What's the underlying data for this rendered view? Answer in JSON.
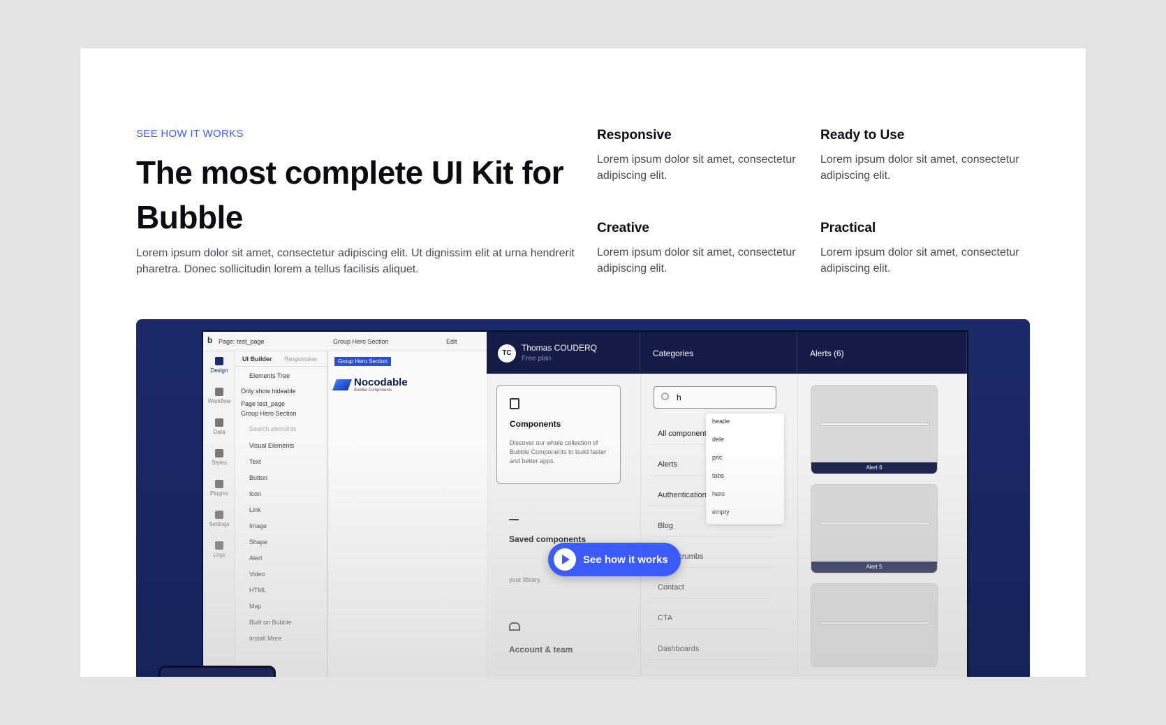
{
  "hero": {
    "eyebrow": "SEE HOW IT WORKS",
    "title": "The most complete UI Kit for Bubble",
    "intro": "Lorem ipsum dolor sit amet, consectetur adipiscing elit. Ut dignissim elit at urna hendrerit pharetra. Donec sollicitudin lorem a tellus facilisis aliquet."
  },
  "features": [
    {
      "title": "Responsive",
      "text": "Lorem ipsum dolor sit amet, consectetur adipiscing elit."
    },
    {
      "title": "Ready to Use",
      "text": "Lorem ipsum dolor sit amet, consectetur adipiscing elit."
    },
    {
      "title": "Creative",
      "text": "Lorem ipsum dolor sit amet, consectetur adipiscing elit."
    },
    {
      "title": "Practical",
      "text": "Lorem ipsum dolor sit amet, consectetur adipiscing elit."
    }
  ],
  "video": {
    "play_label": "See how it works",
    "editor": {
      "page": "Page: test_page",
      "group": "Group Hero Section",
      "edit": "Edit",
      "rail": [
        "Design",
        "Workflow",
        "Data",
        "Styles",
        "Plugins",
        "Settings",
        "Logs"
      ],
      "tabs": [
        "UI Builder",
        "Responsive"
      ],
      "tree": [
        "Elements Tree",
        "Only show hideable",
        "Page test_page",
        "Group Hero Section",
        "Search elements",
        "Visual Elements",
        "Text",
        "Button",
        "Icon",
        "Link",
        "Image",
        "Shape",
        "Alert",
        "Video",
        "HTML",
        "Map",
        "Built on Bubble",
        "Install More"
      ],
      "canvas_tag": "Group Hero Section",
      "logo_name": "Nocodable",
      "logo_sub": "Bubble Components"
    },
    "plugin": {
      "user_initials": "TC",
      "user_name": "Thomas COUDERQ",
      "user_plan": "Free plan",
      "categories_label": "Categories",
      "alerts_label": "Alerts (6)",
      "search_value": "h",
      "suggestions": [
        "heade",
        "dele",
        "pric",
        "tabs",
        "hero",
        "empty"
      ],
      "categories": [
        "All components",
        "Alerts",
        "Authentication",
        "Blog",
        "Breadcrumbs",
        "Contact",
        "CTA",
        "Dashboards"
      ],
      "components_title": "Components",
      "components_text": "Discover our whole collection of Bubble Components to build faster and better apps.",
      "saved_title": "Saved components",
      "saved_text": "your library.",
      "account_title": "Account & team",
      "alerts": [
        "Alert 6",
        "Alert 5"
      ]
    }
  }
}
